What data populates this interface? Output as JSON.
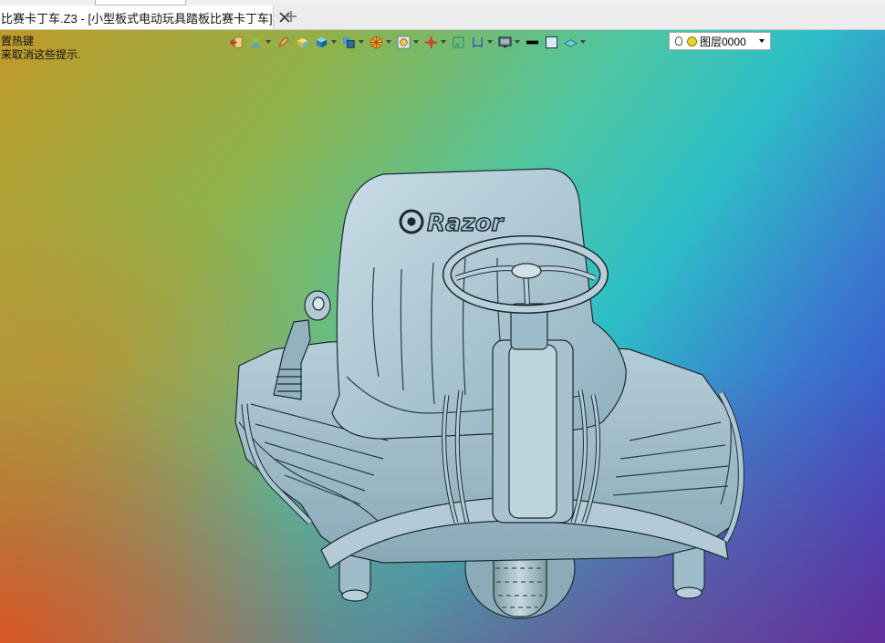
{
  "tab": {
    "title": "比赛卡丁车.Z3 - [小型板式电动玩具踏板比赛卡丁车]"
  },
  "hint": {
    "line1": "置热键",
    "line2": "来取消这些提示."
  },
  "toolbar": {
    "icons": [
      "exit-sketch-icon",
      "render-mode-icon",
      "pencil-icon",
      "shaded-box-icon",
      "cube-icon",
      "multi-view-icon",
      "wheel-icon",
      "zoom-fit-icon",
      "axis-icon",
      "frame-icon",
      "dimension-icon",
      "monitor-icon",
      "black-line-icon",
      "square-icon",
      "plane-icon"
    ],
    "layer_label": "图层0000"
  },
  "model": {
    "brand_text": "Razor"
  },
  "colors": {
    "model_fill": "#a9c5d1",
    "model_edge": "#1c2a30"
  }
}
